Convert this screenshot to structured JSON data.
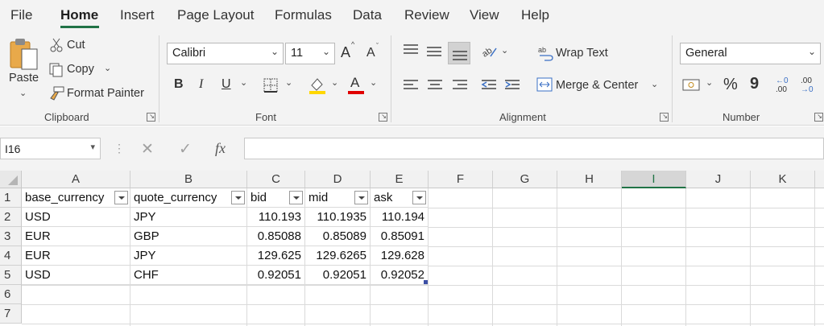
{
  "menu": {
    "tabs": [
      "File",
      "Home",
      "Insert",
      "Page Layout",
      "Formulas",
      "Data",
      "Review",
      "View",
      "Help"
    ],
    "active": "Home"
  },
  "ribbon": {
    "clipboard": {
      "paste": "Paste",
      "cut": "Cut",
      "copy": "Copy",
      "format_painter": "Format Painter",
      "label": "Clipboard"
    },
    "font": {
      "family": "Calibri",
      "size": "11",
      "bold": "B",
      "italic": "I",
      "underline": "U",
      "grow": "A",
      "shrink": "A",
      "color_letter": "A",
      "label": "Font"
    },
    "alignment": {
      "wrap_text": "Wrap Text",
      "merge_center": "Merge & Center",
      "label": "Alignment"
    },
    "number": {
      "format": "General",
      "percent": "%",
      "comma": "9",
      "inc_decimal_top": "←0",
      "inc_decimal_bottom": ".00",
      "dec_decimal_top": ".00",
      "dec_decimal_bottom": "→0",
      "label": "Number"
    }
  },
  "formula_bar": {
    "name_box": "I16",
    "cancel": "✕",
    "enter": "✓",
    "fx": "fx",
    "value": ""
  },
  "sheet": {
    "columns": [
      "A",
      "B",
      "C",
      "D",
      "E",
      "F",
      "G",
      "H",
      "I",
      "J",
      "K"
    ],
    "selected_column": "I",
    "rows": [
      "1",
      "2",
      "3",
      "4",
      "5",
      "6",
      "7"
    ],
    "headers": [
      "base_currency",
      "quote_currency",
      "bid",
      "mid",
      "ask"
    ],
    "data": [
      [
        "USD",
        "JPY",
        "110.193",
        "110.1935",
        "110.194"
      ],
      [
        "EUR",
        "GBP",
        "0.85088",
        "0.85089",
        "0.85091"
      ],
      [
        "EUR",
        "JPY",
        "129.625",
        "129.6265",
        "129.628"
      ],
      [
        "USD",
        "CHF",
        "0.92051",
        "0.92051",
        "0.92052"
      ]
    ]
  },
  "colors": {
    "accent_green": "#217346",
    "font_color_red": "#e00000",
    "fill_yellow": "#ffd700",
    "fill_handle": "#3c4fa5"
  }
}
